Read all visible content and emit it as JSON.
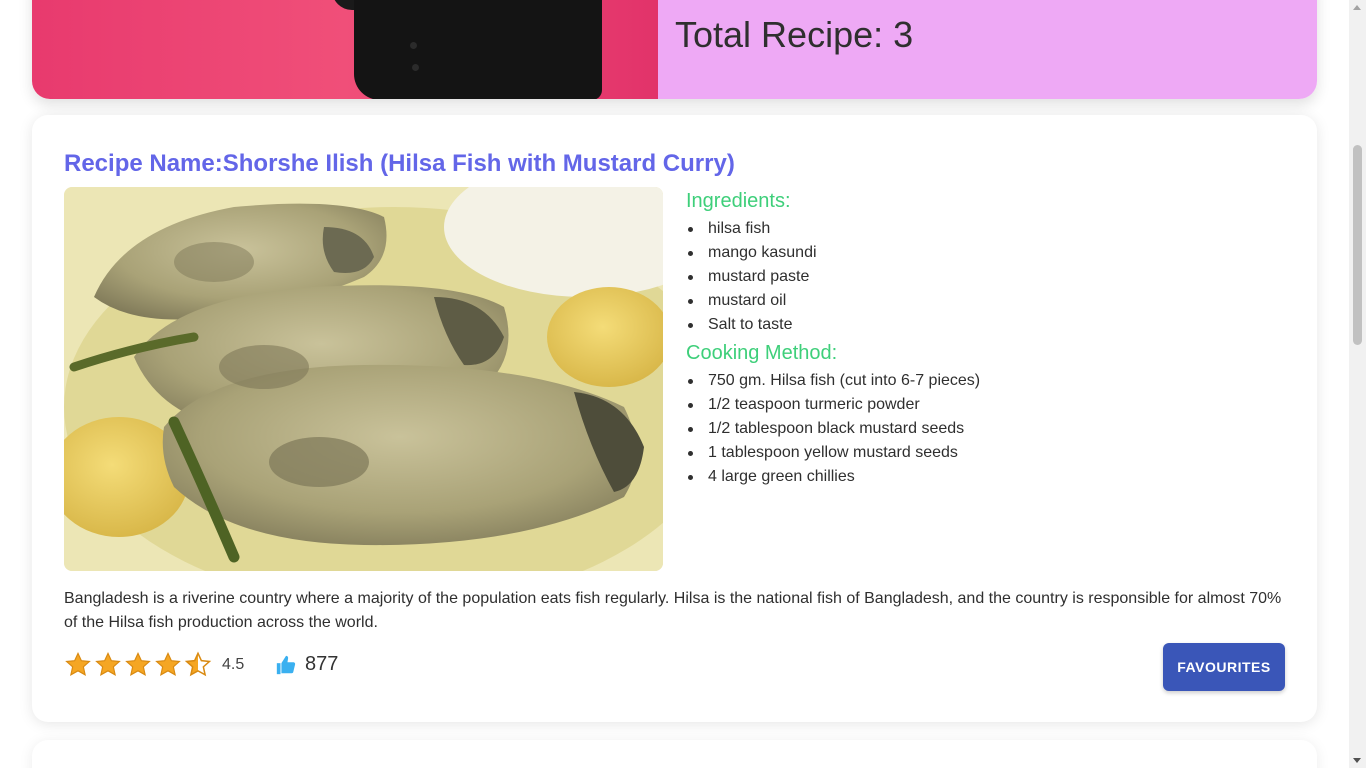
{
  "banner": {
    "partial_heading": "Total Recipe: 3",
    "total_recipes_label": "Total Recipe: 3"
  },
  "recipe": {
    "title_prefix": "Recipe Name:",
    "title_name": "Shorshe Ilish (Hilsa Fish with Mustard Curry)",
    "ingredients_heading": "Ingredients:",
    "ingredients": [
      "hilsa fish",
      "mango kasundi",
      "mustard paste",
      "mustard oil",
      "Salt to taste"
    ],
    "method_heading": "Cooking Method:",
    "method": [
      "750 gm. Hilsa fish (cut into 6-7 pieces)",
      "1/2 teaspoon turmeric powder",
      "1/2 tablespoon black mustard seeds",
      "1 tablespoon yellow mustard seeds",
      "4 large green chillies"
    ],
    "description": "Bangladesh is a riverine country where a majority of the population eats fish regularly. Hilsa is the national fish of Bangladesh, and the country is responsible for almost 70% of the Hilsa fish production across the world.",
    "rating": 4.5,
    "rating_label": "4.5",
    "likes": "877",
    "favourite_button": "FAVOURITES"
  },
  "colors": {
    "title": "#6366e8",
    "section_heading": "#3ecf7a",
    "button": "#3a56b8",
    "banner_info_bg": "#eea9f5",
    "banner_photo_bg": "#e83a6e",
    "star": "#f5a623",
    "thumb": "#3ab0f0"
  },
  "icons": {
    "star": "star-icon",
    "half_star": "half-star-icon",
    "like": "thumbs-up-icon"
  }
}
